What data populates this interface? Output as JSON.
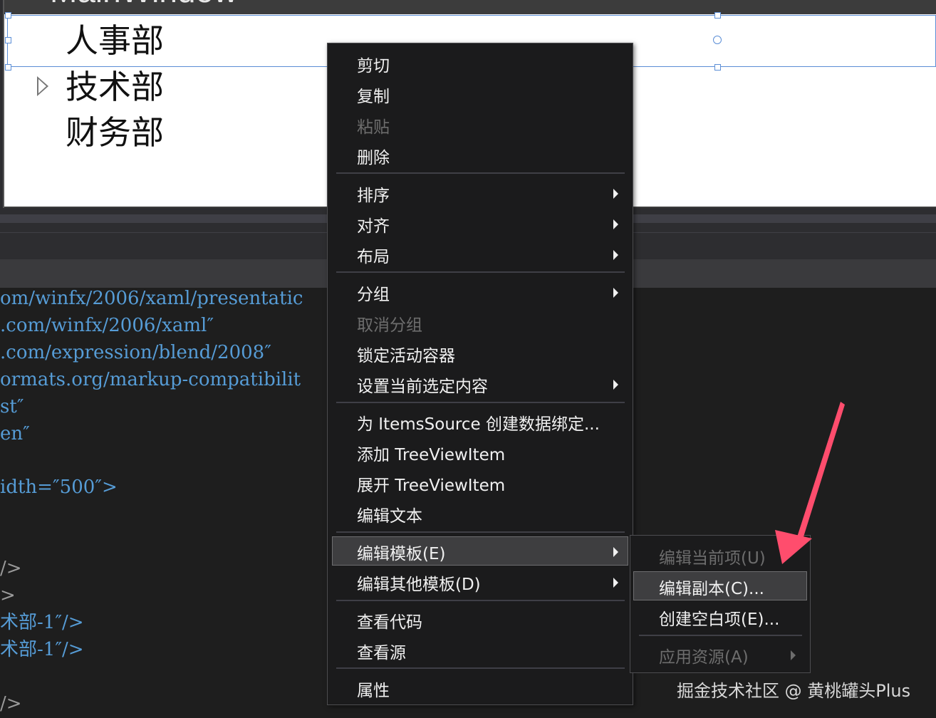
{
  "designer": {
    "window_title": "MainWindow",
    "tree_items": [
      "人事部",
      "技术部",
      "财务部"
    ]
  },
  "code_lines": [
    {
      "text": "om/winfx/2006/xaml/presentatic",
      "gray": false
    },
    {
      "text": ".com/winfx/2006/xaml″",
      "gray": false
    },
    {
      "text": ".com/expression/blend/2008″",
      "gray": false
    },
    {
      "text": "ormats.org/markup-compatibilit",
      "gray": false
    },
    {
      "text": "st″",
      "gray": false
    },
    {
      "text": "en″",
      "gray": false
    },
    {
      "text": "idth=″500″>",
      "gray": false
    },
    {
      "text": "/>",
      "gray": true
    },
    {
      "text": ">",
      "gray": true
    },
    {
      "text": "术部-1″/>",
      "gray": false
    },
    {
      "text": "术部-1″/>",
      "gray": false
    },
    {
      "text": "/>",
      "gray": true
    }
  ],
  "context_menu": {
    "items": [
      {
        "label": "剪切"
      },
      {
        "label": "复制"
      },
      {
        "label": "粘贴",
        "disabled": true
      },
      {
        "label": "删除"
      },
      {
        "label": "排序",
        "submenu": true
      },
      {
        "label": "对齐",
        "submenu": true
      },
      {
        "label": "布局",
        "submenu": true
      },
      {
        "label": "分组",
        "submenu": true
      },
      {
        "label": "取消分组",
        "disabled": true
      },
      {
        "label": "锁定活动容器"
      },
      {
        "label": "设置当前选定内容",
        "submenu": true
      },
      {
        "label": "为 ItemsSource 创建数据绑定..."
      },
      {
        "label": "添加 TreeViewItem"
      },
      {
        "label": "展开 TreeViewItem"
      },
      {
        "label": "编辑文本"
      },
      {
        "label": "编辑模板(E)",
        "submenu": true,
        "highlighted": true
      },
      {
        "label": "编辑其他模板(D)",
        "submenu": true
      },
      {
        "label": "查看代码"
      },
      {
        "label": "查看源"
      },
      {
        "label": "属性"
      }
    ]
  },
  "template_submenu": {
    "items": [
      {
        "label": "编辑当前项(U)",
        "disabled": true
      },
      {
        "label": "编辑副本(C)...",
        "highlighted": true
      },
      {
        "label": "创建空白项(E)..."
      },
      {
        "label": "应用资源(A)",
        "disabled": true,
        "submenu": true
      }
    ]
  },
  "watermark": "掘金技术社区 @ 黄桃罐头Plus",
  "colors": {
    "menu_bg": "#1b1b1c",
    "highlight": "#3e3e40",
    "code_blue": "#569cd6",
    "annotation_arrow": "#ff4d6d",
    "selection_blue": "#5b8ed6"
  }
}
